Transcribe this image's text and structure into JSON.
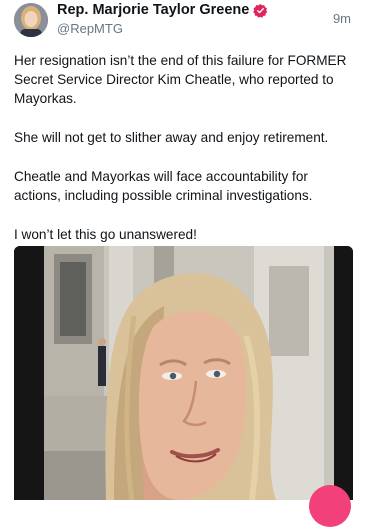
{
  "post": {
    "author_name": "Rep. Marjorie Taylor Greene",
    "handle": "@RepMTG",
    "timestamp": "9m",
    "paragraphs": [
      "Her resignation isn’t the end of this failure for FORMER Secret Service Director Kim Cheatle, who reported to Mayorkas.",
      "She will not get to slither away and enjoy retirement.",
      "Cheatle and Mayorkas will face accountability for actions, including possible criminal investigations.",
      "I won’t let this go unanswered!"
    ]
  },
  "icons": {
    "avatar": "profile-photo",
    "verified": "verified-badge-icon",
    "fab": "compose-button"
  },
  "colors": {
    "verified_badge": "#e0245e",
    "secondary_text": "#657786",
    "fab": "#f2407a"
  }
}
